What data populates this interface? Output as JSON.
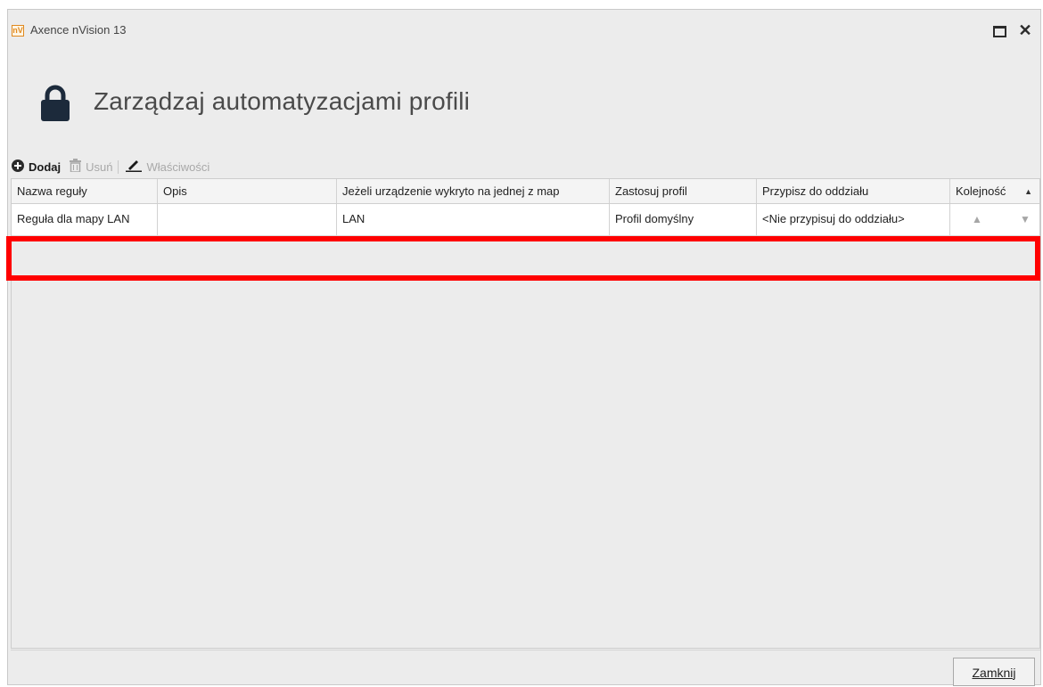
{
  "window": {
    "app_logo_text": "nV",
    "title": "Axence nVision 13",
    "maximize_icon": "maximize-icon",
    "close_icon": "close-icon",
    "close_glyph": "✕"
  },
  "header": {
    "icon": "lock-icon",
    "title": "Zarządzaj automatyzacjami profili"
  },
  "toolbar": {
    "add_label": "Dodaj",
    "remove_label": "Usuń",
    "properties_label": "Właściwości"
  },
  "grid": {
    "columns": [
      "Nazwa reguły",
      "Opis",
      "Jeżeli urządzenie wykryto na jednej z map",
      "Zastosuj profil",
      "Przypisz do oddziału",
      "Kolejność"
    ],
    "sort_glyph": "▲",
    "rows": [
      {
        "name": "Reguła dla mapy LAN",
        "description": "",
        "maps": "LAN",
        "profile": "Profil domyślny",
        "branch": "<Nie przypisuj do oddziału>",
        "order_up": "▲",
        "order_down": "▼"
      }
    ]
  },
  "footer": {
    "close_button": "Zamknij"
  },
  "colors": {
    "highlight": "#ff0000",
    "lock": "#1c2a3b"
  }
}
